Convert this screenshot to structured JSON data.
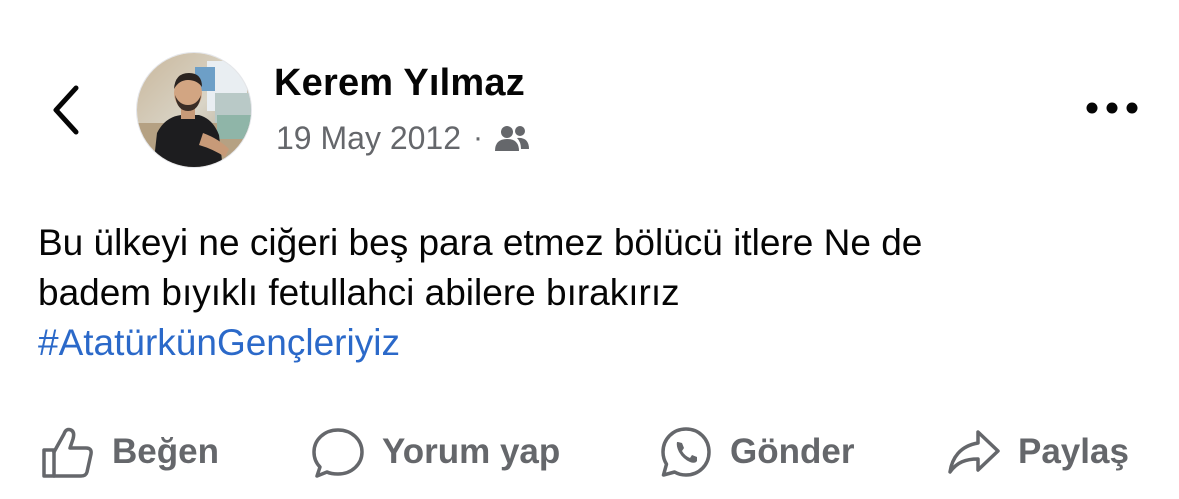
{
  "post": {
    "author": "Kerem Yılmaz",
    "date": "19 May 2012",
    "separator": "·",
    "audience_icon": "friends-icon",
    "text_lines": [
      "Bu ülkeyi ne ciğeri beş para etmez bölücü itlere Ne de",
      "badem bıyıklı fetullahci abilere bırakırız"
    ],
    "hashtag": "#AtatürkünGençleriyiz"
  },
  "actions": {
    "like": "Beğen",
    "comment": "Yorum yap",
    "send": "Gönder",
    "share": "Paylaş"
  },
  "colors": {
    "text": "#050505",
    "secondary": "#65676b",
    "link": "#2b69c9",
    "background": "#ffffff"
  },
  "icons": {
    "back": "chevron-left-icon",
    "more": "more-dots-icon",
    "like": "thumbs-up-icon",
    "comment": "comment-bubble-icon",
    "send": "whatsapp-icon",
    "share": "share-arrow-icon"
  }
}
